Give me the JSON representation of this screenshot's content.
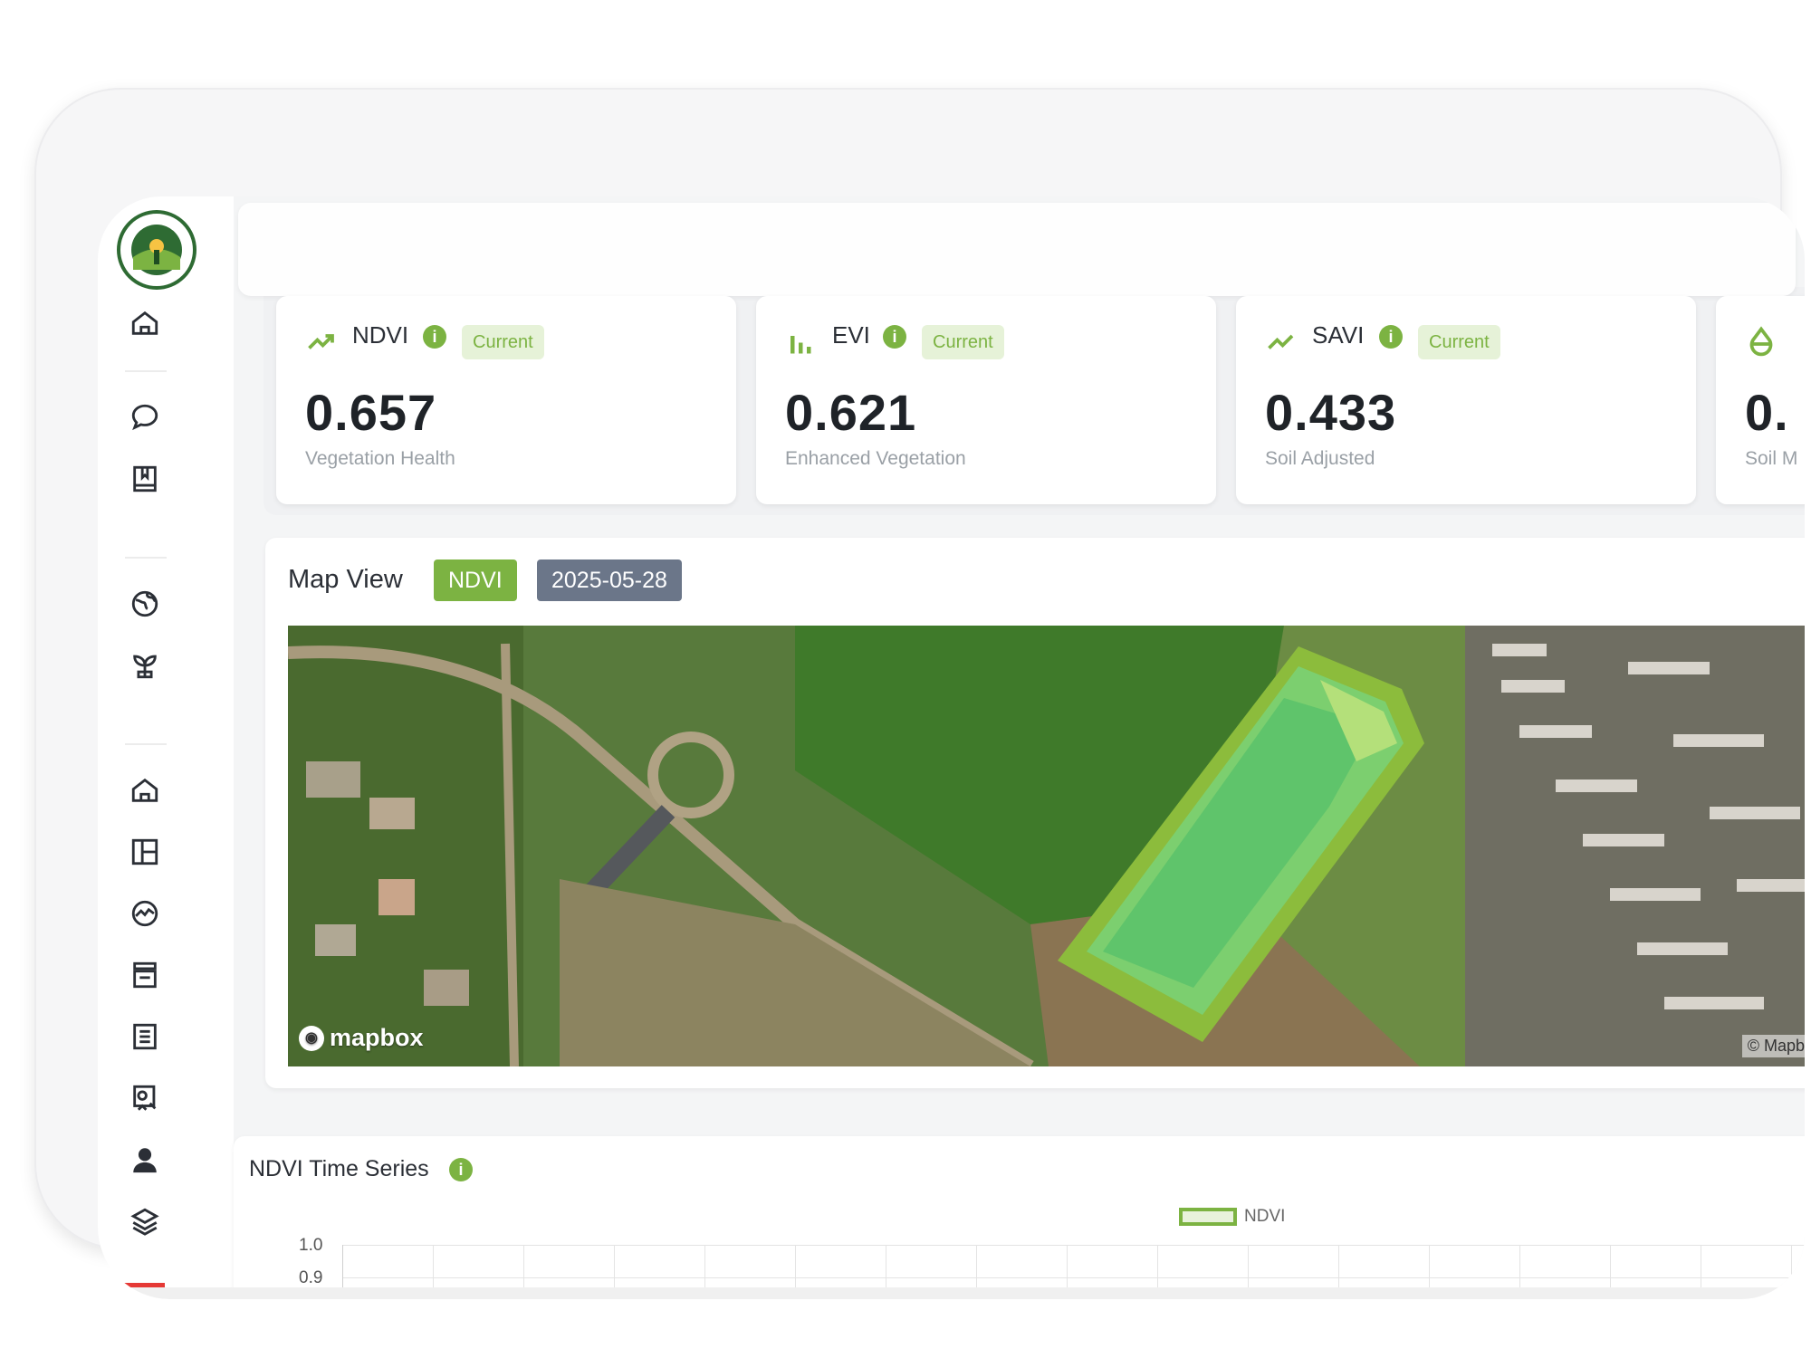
{
  "colors": {
    "accent": "#7cb342",
    "badge_bg": "#e6f2d8",
    "date_tag": "#6b7689",
    "sidebar": "#ffffff"
  },
  "sidebar": {
    "logo_icon": "nis-grow-logo",
    "items": [
      {
        "icon": "home-icon"
      },
      {
        "icon": "chat-bubble-icon"
      },
      {
        "icon": "book-icon"
      },
      {
        "icon": "globe-icon"
      },
      {
        "icon": "plant-icon"
      },
      {
        "icon": "home-icon"
      },
      {
        "icon": "layout-icon"
      },
      {
        "icon": "analytics-icon"
      },
      {
        "icon": "archive-icon"
      },
      {
        "icon": "list-icon"
      },
      {
        "icon": "report-icon"
      },
      {
        "icon": "user-icon"
      },
      {
        "icon": "layers-icon"
      }
    ]
  },
  "kpis": [
    {
      "name": "NDVI",
      "badge": "Current",
      "value": "0.657",
      "sub": "Vegetation Health",
      "icon": "trend-up-icon"
    },
    {
      "name": "EVI",
      "badge": "Current",
      "value": "0.621",
      "sub": "Enhanced Vegetation",
      "icon": "bar-chart-icon"
    },
    {
      "name": "SAVI",
      "badge": "Current",
      "value": "0.433",
      "sub": "Soil Adjusted",
      "icon": "trend-up-icon"
    },
    {
      "name": "",
      "badge": "",
      "value": "0.",
      "sub": "Soil M",
      "icon": "droplet-icon"
    }
  ],
  "map": {
    "title": "Map View",
    "index_tag": "NDVI",
    "date_tag": "2025-05-28",
    "logo_text": "mapbox",
    "attribution": "© Mapbox"
  },
  "timeseries": {
    "title": "NDVI Time Series",
    "legend": "NDVI",
    "yticks": [
      "1.0",
      "0.9"
    ]
  }
}
